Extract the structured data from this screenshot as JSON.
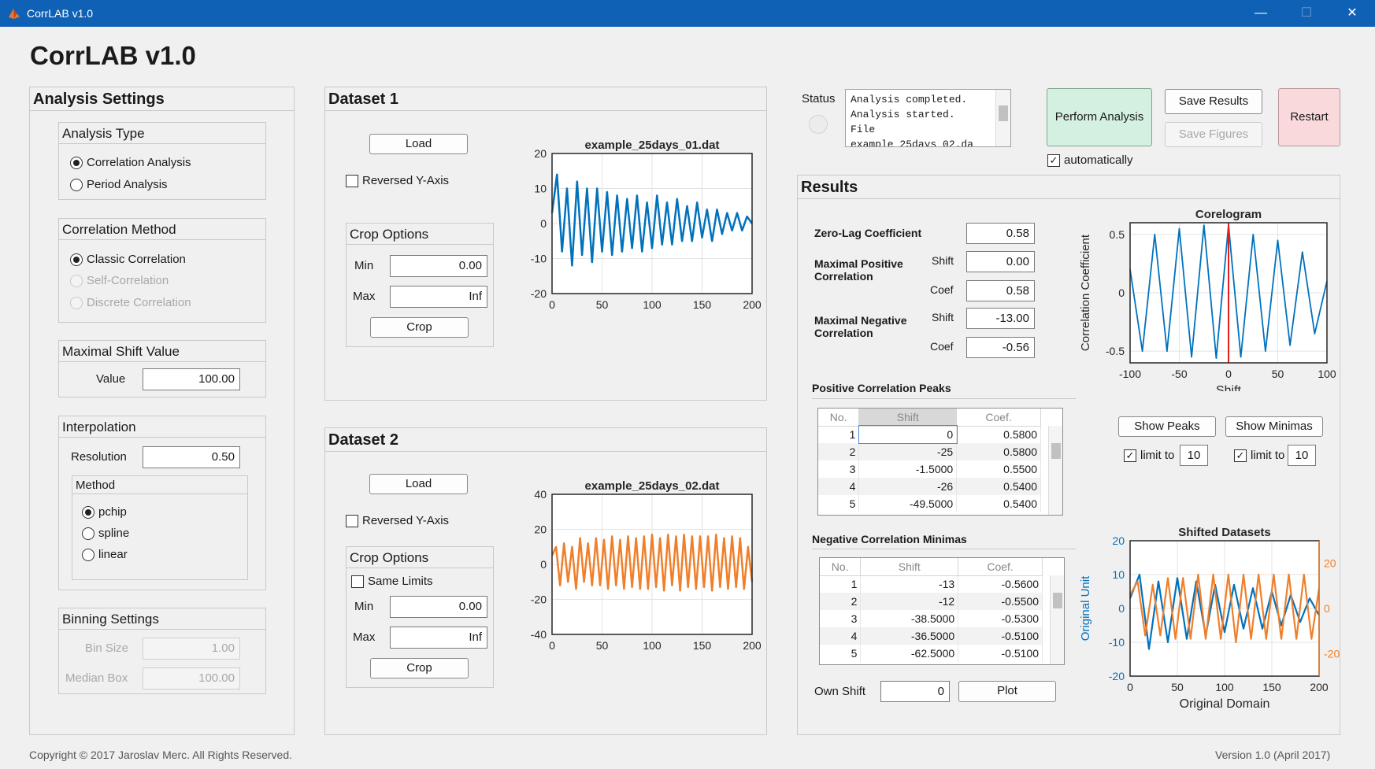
{
  "window": {
    "title": "CorrLAB v1.0",
    "minimize": "—",
    "maximize": "☐",
    "close": "✕"
  },
  "app_title": "CorrLAB v1.0",
  "analysis": {
    "title": "Analysis Settings",
    "type": {
      "title": "Analysis Type",
      "options": [
        "Correlation Analysis",
        "Period Analysis"
      ],
      "selected": 0
    },
    "method": {
      "title": "Correlation Method",
      "options": [
        "Classic Correlation",
        "Self-Correlation",
        "Discrete Correlation"
      ]
    },
    "shift": {
      "title": "Maximal Shift Value",
      "label": "Value",
      "value": "100.00"
    },
    "interp": {
      "title": "Interpolation",
      "res_label": "Resolution",
      "res_value": "0.50",
      "method_title": "Method",
      "methods": [
        "pchip",
        "spline",
        "linear"
      ]
    },
    "binning": {
      "title": "Binning Settings",
      "bin_label": "Bin Size",
      "bin_value": "1.00",
      "median_label": "Median Box",
      "median_value": "100.00"
    }
  },
  "dataset1": {
    "title": "Dataset 1",
    "load": "Load",
    "reversed": "Reversed Y-Axis",
    "crop_title": "Crop Options",
    "min_label": "Min",
    "min_value": "0.00",
    "max_label": "Max",
    "max_value": "Inf",
    "crop": "Crop",
    "plot_title": "example_25days_01.dat"
  },
  "dataset2": {
    "title": "Dataset 2",
    "load": "Load",
    "reversed": "Reversed Y-Axis",
    "crop_title": "Crop Options",
    "same_limits": "Same Limits",
    "min_label": "Min",
    "min_value": "0.00",
    "max_label": "Max",
    "max_value": "Inf",
    "crop": "Crop",
    "plot_title": "example_25days_02.dat"
  },
  "status": {
    "label": "Status",
    "log": [
      "Analysis completed.",
      "Analysis started.",
      "File",
      "example_25days_02.da"
    ],
    "perform": "Perform Analysis",
    "save_results": "Save Results",
    "save_figures": "Save Figures",
    "restart": "Restart",
    "automatically": "automatically"
  },
  "results": {
    "title": "Results",
    "zero_lag_label": "Zero-Lag Coefficient",
    "zero_lag": "0.58",
    "max_pos_label": "Maximal Positive Correlation",
    "max_neg_label": "Maximal Negative Correlation",
    "shift_label": "Shift",
    "coef_label": "Coef",
    "pos_shift": "0.00",
    "pos_coef": "0.58",
    "neg_shift": "-13.00",
    "neg_coef": "-0.56",
    "pos_peaks": {
      "title": "Positive Correlation Peaks",
      "headers": [
        "No.",
        "Shift",
        "Coef."
      ],
      "rows": [
        [
          "1",
          "0",
          "0.5800"
        ],
        [
          "2",
          "-25",
          "0.5800"
        ],
        [
          "3",
          "-1.5000",
          "0.5500"
        ],
        [
          "4",
          "-26",
          "0.5400"
        ],
        [
          "5",
          "-49.5000",
          "0.5400"
        ]
      ]
    },
    "neg_min": {
      "title": "Negative Correlation Minimas",
      "headers": [
        "No.",
        "Shift",
        "Coef."
      ],
      "rows": [
        [
          "1",
          "-13",
          "-0.5600"
        ],
        [
          "2",
          "-12",
          "-0.5500"
        ],
        [
          "3",
          "-38.5000",
          "-0.5300"
        ],
        [
          "4",
          "-36.5000",
          "-0.5100"
        ],
        [
          "5",
          "-62.5000",
          "-0.5100"
        ]
      ]
    },
    "own_shift_label": "Own Shift",
    "own_shift": "0",
    "plot": "Plot",
    "show_peaks": "Show Peaks",
    "show_minimas": "Show Minimas",
    "limit_label": "limit to",
    "limit_peaks": "10",
    "limit_minimas": "10"
  },
  "chart_data": [
    {
      "type": "line",
      "title": "example_25days_01.dat",
      "xlabel": "",
      "ylabel": "",
      "xlim": [
        0,
        200
      ],
      "ylim": [
        -20,
        20
      ],
      "xticks": [
        0,
        50,
        100,
        150,
        200
      ],
      "yticks": [
        20,
        10,
        0,
        -10,
        -20
      ],
      "color": "#0072bd",
      "series": [
        {
          "x": [
            0,
            5,
            10,
            15,
            20,
            25,
            30,
            35,
            40,
            45,
            50,
            55,
            60,
            65,
            70,
            75,
            80,
            85,
            90,
            95,
            100,
            105,
            110,
            115,
            120,
            125,
            130,
            135,
            140,
            145,
            150,
            155,
            160,
            165,
            170,
            175,
            180,
            185,
            190,
            195,
            200
          ],
          "values": [
            3,
            14,
            -8,
            10,
            -12,
            12,
            -9,
            10,
            -11,
            10,
            -8,
            9,
            -9,
            8,
            -8,
            7,
            -7,
            8,
            -8,
            6,
            -7,
            8,
            -6,
            6,
            -6,
            7,
            -5,
            5,
            -5,
            6,
            -4,
            4,
            -5,
            4,
            -3,
            3,
            -2,
            3,
            -2,
            2,
            0
          ]
        }
      ]
    },
    {
      "type": "line",
      "title": "example_25days_02.dat",
      "xlabel": "",
      "ylabel": "",
      "xlim": [
        0,
        200
      ],
      "ylim": [
        -40,
        40
      ],
      "xticks": [
        0,
        50,
        100,
        150,
        200
      ],
      "yticks": [
        40,
        20,
        0,
        -20,
        -40
      ],
      "color": "#f07f2a",
      "series": [
        {
          "x": [
            0,
            4,
            8,
            12,
            16,
            20,
            24,
            28,
            32,
            36,
            40,
            44,
            48,
            52,
            56,
            60,
            64,
            68,
            72,
            76,
            80,
            84,
            88,
            92,
            96,
            100,
            104,
            108,
            112,
            116,
            120,
            124,
            128,
            132,
            136,
            140,
            144,
            148,
            152,
            156,
            160,
            164,
            168,
            172,
            176,
            180,
            184,
            188,
            192,
            196,
            200
          ],
          "values": [
            5,
            10,
            -12,
            12,
            -10,
            10,
            -14,
            15,
            -10,
            12,
            -12,
            15,
            -12,
            14,
            -14,
            16,
            -12,
            14,
            -14,
            16,
            -13,
            15,
            -14,
            16,
            -14,
            17,
            -13,
            15,
            -15,
            17,
            -12,
            16,
            -15,
            17,
            -13,
            16,
            -14,
            16,
            -13,
            16,
            -15,
            17,
            -13,
            15,
            -14,
            16,
            -13,
            15,
            -14,
            10,
            -10
          ]
        }
      ]
    },
    {
      "type": "line",
      "title": "Corelogram",
      "xlabel": "Shift",
      "ylabel": "Correlation Coefficient",
      "xlim": [
        -100,
        100
      ],
      "ylim": [
        -0.6,
        0.6
      ],
      "xticks": [
        -100,
        -50,
        0,
        50,
        100
      ],
      "yticks": [
        0.5,
        0,
        -0.5
      ],
      "color": "#0072bd",
      "marker_x": 0,
      "marker_color": "#e0201c",
      "series": [
        {
          "x": [
            -100,
            -87.5,
            -75,
            -62.5,
            -50,
            -37.5,
            -25,
            -12.5,
            0,
            12.5,
            25,
            37.5,
            50,
            62.5,
            75,
            87.5,
            100
          ],
          "values": [
            0.2,
            -0.5,
            0.5,
            -0.5,
            0.55,
            -0.55,
            0.58,
            -0.56,
            0.58,
            -0.55,
            0.5,
            -0.5,
            0.45,
            -0.45,
            0.35,
            -0.35,
            0.1
          ]
        }
      ]
    },
    {
      "type": "line",
      "title": "Shifted Datasets",
      "xlabel": "Original Domain",
      "ylabel": "Original Unit",
      "xlim": [
        0,
        200
      ],
      "ylim": [
        -20,
        20
      ],
      "xticks": [
        0,
        50,
        100,
        150,
        200
      ],
      "yticks": [
        20,
        10,
        0,
        -10,
        -20
      ],
      "y2ticks": [
        20,
        0,
        -20
      ],
      "y2color": "#f07f2a",
      "series": [
        {
          "color": "#0072bd",
          "x": [
            0,
            10,
            20,
            30,
            40,
            50,
            60,
            70,
            80,
            90,
            100,
            110,
            120,
            130,
            140,
            150,
            160,
            170,
            180,
            190,
            200
          ],
          "values": [
            3,
            10,
            -12,
            8,
            -10,
            9,
            -9,
            8,
            -8,
            7,
            -7,
            7,
            -6,
            6,
            -6,
            5,
            -5,
            4,
            -4,
            3,
            -2
          ]
        },
        {
          "color": "#f07f2a",
          "x": [
            0,
            8,
            16,
            24,
            32,
            40,
            48,
            56,
            64,
            72,
            80,
            88,
            96,
            104,
            112,
            120,
            128,
            136,
            144,
            152,
            160,
            168,
            176,
            184,
            192,
            200
          ],
          "values": [
            4,
            8,
            -8,
            7,
            -8,
            9,
            -9,
            9,
            -9,
            10,
            -9,
            10,
            -9,
            10,
            -10,
            10,
            -9,
            10,
            -9,
            10,
            -9,
            10,
            -9,
            10,
            -9,
            6
          ]
        }
      ]
    }
  ],
  "footer": {
    "copyright": "Copyright © 2017 Jaroslav Merc. All Rights Reserved.",
    "version": "Version 1.0 (April 2017)"
  }
}
